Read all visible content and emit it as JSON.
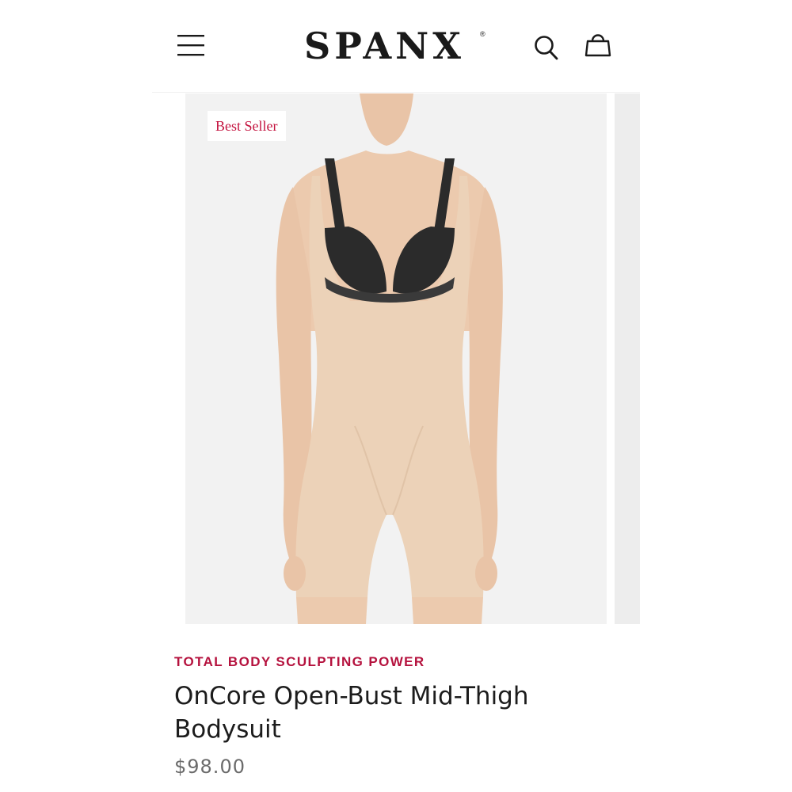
{
  "header": {
    "logo": "SPANX",
    "logo_mark": "®",
    "menu_icon": "hamburger-menu-icon",
    "search_icon": "search-icon",
    "bag_icon": "shopping-bag-icon"
  },
  "product": {
    "badge": "Best Seller",
    "category": "TOTAL BODY SCULPTING POWER",
    "name": "OnCore Open-Bust Mid-Thigh Bodysuit",
    "price": "$98.00"
  },
  "colors": {
    "accent": "#b5123e",
    "badge_text": "#c4133f",
    "image_background": "#f2f2f2",
    "garment": "#ecd2b8",
    "bra": "#2b2b2b"
  }
}
